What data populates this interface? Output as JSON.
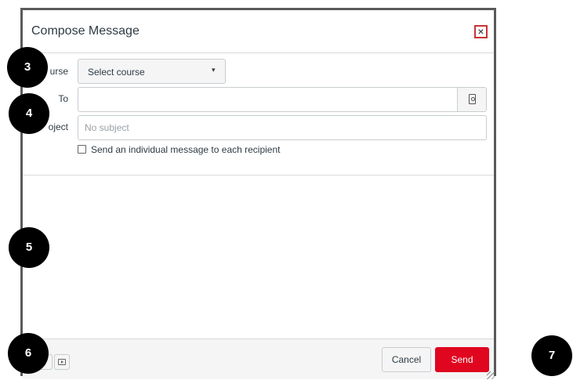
{
  "dialog": {
    "title": "Compose Message",
    "close_label": "×"
  },
  "form": {
    "course_label": "urse",
    "course_value": "Select course",
    "course_caret": "▾",
    "to_label": "To",
    "subject_label": "oject",
    "subject_placeholder": "No subject",
    "individual_message_label": "Send an individual message to each recipient"
  },
  "footer": {
    "cancel_label": "Cancel",
    "send_label": "Send"
  },
  "callouts": [
    "3",
    "4",
    "5",
    "6",
    "7"
  ],
  "colors": {
    "send_button": "#e0061f",
    "close_border": "#cc3333",
    "callout_bg": "#000000"
  }
}
